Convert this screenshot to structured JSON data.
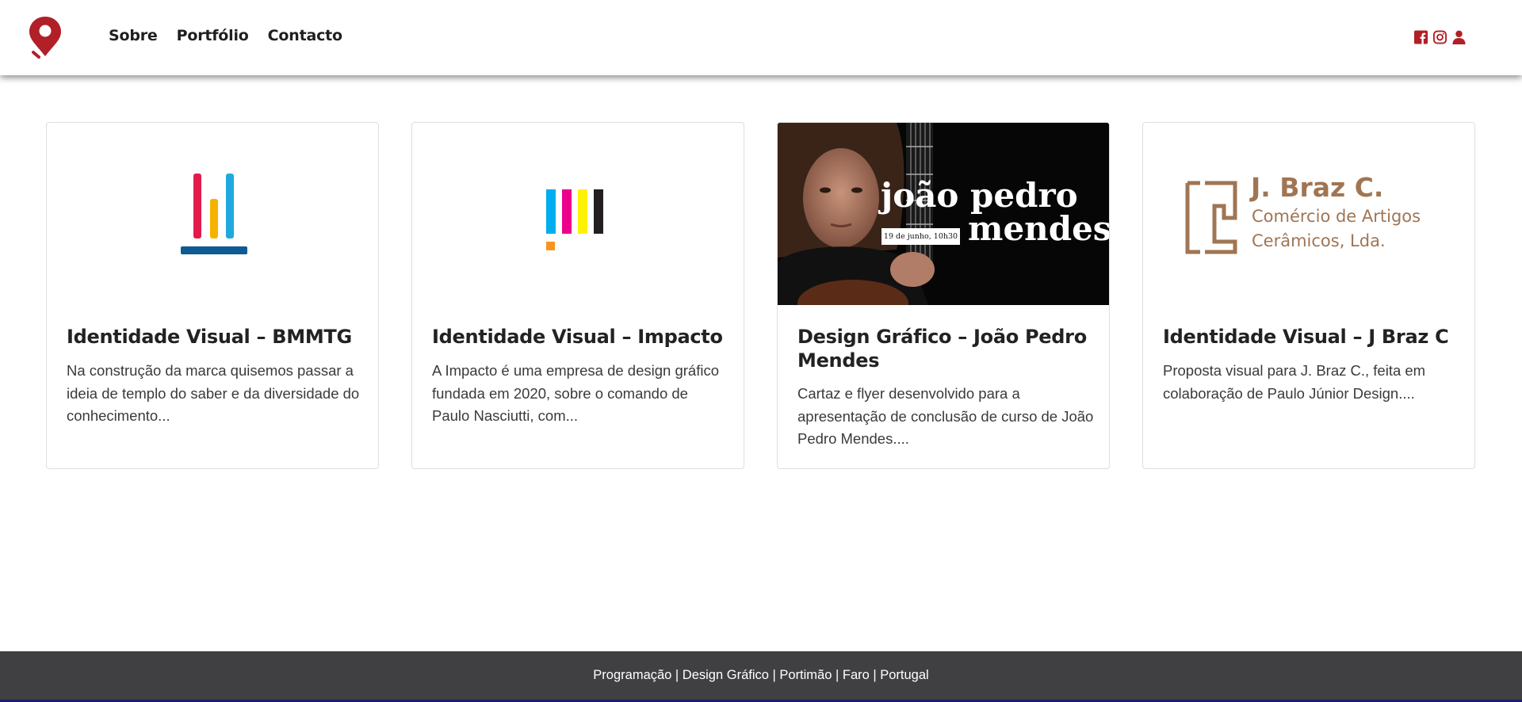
{
  "colors": {
    "brand_red": "#b11f27",
    "footer_bg": "#404042",
    "card_border": "#dedede",
    "braz_brown": "#a07553"
  },
  "nav": {
    "logo_icon": "map-pin-logo",
    "links": [
      "Sobre",
      "Portfólio",
      "Contacto"
    ],
    "social_icons": [
      "facebook-icon",
      "instagram-icon",
      "user-icon"
    ]
  },
  "cards": [
    {
      "title": "Identidade Visual – BMMTG",
      "text": "Na construção da marca quisemos passar a ideia de templo do saber e da diversidade do conhecimento..."
    },
    {
      "title": "Identidade Visual – Impacto",
      "text": "A Impacto é uma empresa de design gráfico fundada em 2020, sobre o comando de Paulo Nasciutti, com..."
    },
    {
      "title": "Design Gráfico – João Pedro Mendes",
      "text": "Cartaz e flyer desenvolvido para a apresentação de conclusão de curso de João Pedro Mendes....",
      "poster": {
        "name_line1": "joão pedro",
        "name_line2": "mendes",
        "date": "19 de junho, 10h30"
      }
    },
    {
      "title": "Identidade Visual – J Braz C",
      "text": "Proposta visual para J. Braz C., feita em colaboração de Paulo Júnior Design....",
      "logo": {
        "name": "J. Braz C.",
        "line1": "Comércio de Artigos",
        "line2": "Cerâmicos, Lda."
      }
    }
  ],
  "footer": {
    "text": "Programação | Design Gráfico | Portimão | Faro | Portugal"
  }
}
